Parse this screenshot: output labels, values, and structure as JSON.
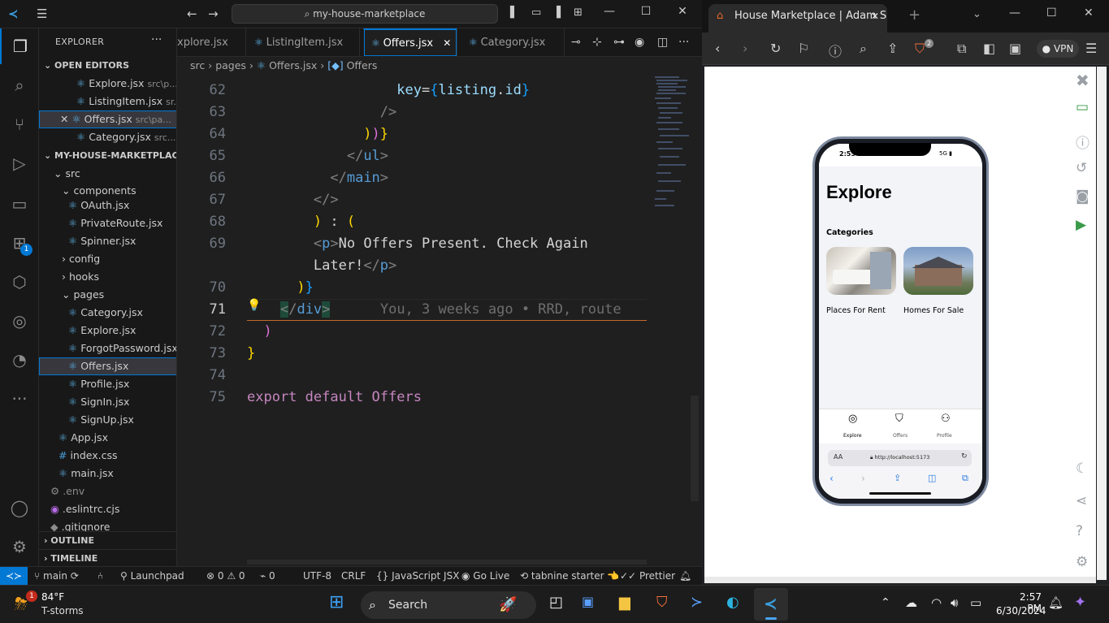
{
  "vscode": {
    "command_center": "my-house-marketplace",
    "explorer_title": "EXPLORER",
    "open_editors_header": "OPEN EDITORS",
    "open_editors": [
      {
        "name": "Explore.jsx",
        "path": "src\\p..."
      },
      {
        "name": "ListingItem.jsx",
        "path": "sr..."
      },
      {
        "name": "Offers.jsx",
        "path": "src\\pa..."
      },
      {
        "name": "Category.jsx",
        "path": "src..."
      }
    ],
    "project_header": "MY-HOUSE-MARKETPLACE",
    "tree": {
      "src": "src",
      "components": "components",
      "components_files": [
        "OAuth.jsx",
        "PrivateRoute.jsx",
        "Spinner.jsx"
      ],
      "config": "config",
      "hooks": "hooks",
      "pages": "pages",
      "pages_files": [
        "Category.jsx",
        "Explore.jsx",
        "ForgotPassword.jsx",
        "Offers.jsx",
        "Profile.jsx",
        "SignIn.jsx",
        "SignUp.jsx"
      ],
      "root_files": [
        "App.jsx",
        "index.css",
        "main.jsx"
      ],
      "dot_files": [
        ".env",
        ".eslintrc.cjs",
        ".gitignore"
      ]
    },
    "outline": "OUTLINE",
    "timeline": "TIMELINE",
    "tabs": [
      "xplore.jsx",
      "ListingItem.jsx",
      "Offers.jsx",
      "Category.jsx"
    ],
    "breadcrumb": [
      "src",
      "pages",
      "Offers.jsx",
      "Offers"
    ],
    "line_numbers": [
      "62",
      "63",
      "64",
      "65",
      "66",
      "67",
      "68",
      "69",
      "",
      "70",
      "71",
      "72",
      "73",
      "74",
      "75"
    ],
    "blame": "You, 3 weeks ago • RRD, route",
    "status": {
      "branch": "main",
      "launchpad": "Launchpad",
      "errors": "0",
      "warnings": "0",
      "ports": "0",
      "encoding": "UTF-8",
      "eol": "CRLF",
      "language": "JavaScript JSX",
      "golive": "Go Live",
      "tabnine": "tabnine starter",
      "prettier": "Prettier"
    }
  },
  "browser": {
    "tab_title": "House Marketplace | Adam S",
    "vpn": "VPN",
    "shield_count": "2",
    "phone": {
      "time": "2:55 PM",
      "signal": "5G",
      "heading": "Explore",
      "categories_label": "Categories",
      "categories": [
        "Places For Rent",
        "Homes For Sale"
      ],
      "nav": [
        "Explore",
        "Offers",
        "Profile"
      ],
      "url": "http://localhost:5173",
      "aa": "AA"
    }
  },
  "taskbar": {
    "weather_temp": "84°F",
    "weather_desc": "T-storms",
    "weather_badge": "1",
    "search": "Search",
    "time": "2:57 PM",
    "date": "6/30/2024"
  }
}
